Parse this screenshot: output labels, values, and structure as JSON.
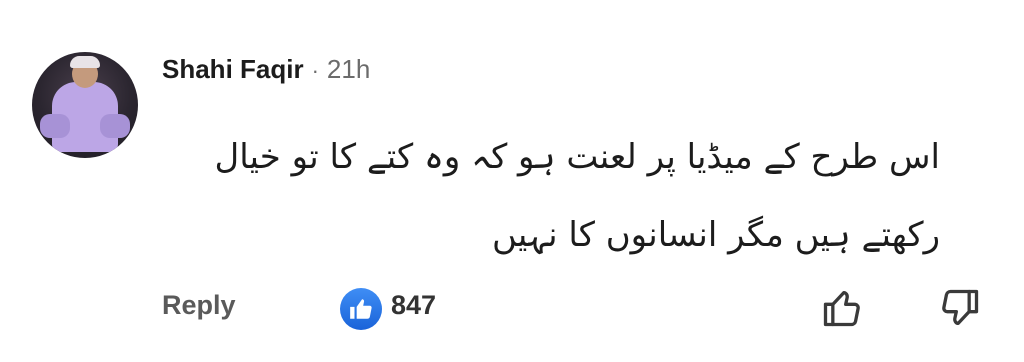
{
  "comment": {
    "author": "Shahi Faqir",
    "separator": "·",
    "time": "21h",
    "text_line1": "اس طرح کے میڈیا پر لعنت ہو کہ وہ کتے کا تو خیال",
    "text_line2": "رکھتے ہیں مگر انسانوں کا نہیں"
  },
  "actions": {
    "reply_label": "Reply",
    "reaction_count": "847",
    "reaction_icon": "like-icon",
    "upvote_icon": "thumbs-up-outline-icon",
    "downvote_icon": "thumbs-down-outline-icon"
  },
  "colors": {
    "like_blue": "#1a63d9",
    "text": "#1c1c1c",
    "muted": "#6b6b6b"
  }
}
